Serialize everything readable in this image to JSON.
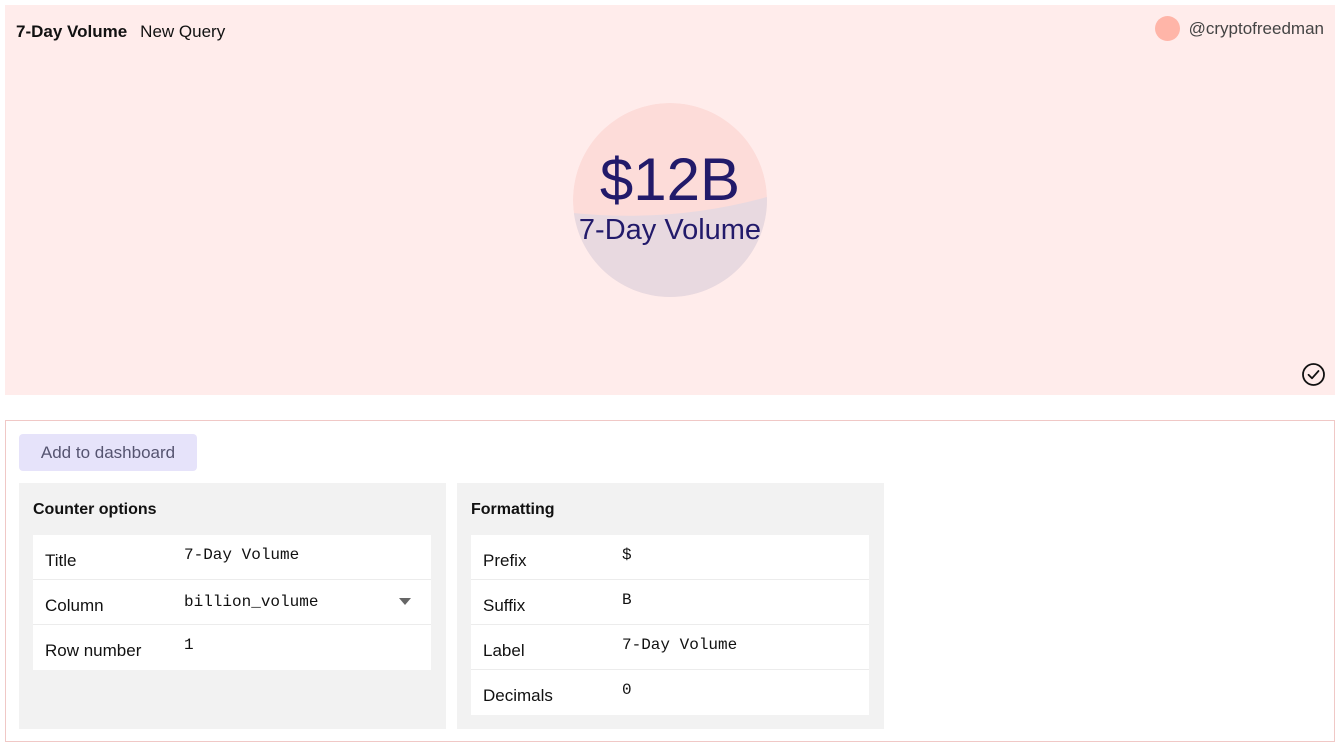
{
  "header": {
    "query_title": "7-Day Volume",
    "query_name": "New Query",
    "author": "@cryptofreedman"
  },
  "counter": {
    "value": "$12B",
    "label": "7-Day Volume"
  },
  "actions": {
    "add_to_dashboard": "Add to dashboard"
  },
  "counter_options": {
    "title": "Counter options",
    "rows": [
      {
        "label": "Title",
        "value": "7-Day Volume"
      },
      {
        "label": "Column",
        "value": "billion_volume"
      },
      {
        "label": "Row number",
        "value": "1"
      }
    ]
  },
  "formatting": {
    "title": "Formatting",
    "rows": [
      {
        "label": "Prefix",
        "value": "$"
      },
      {
        "label": "Suffix",
        "value": "B"
      },
      {
        "label": "Label",
        "value": "7-Day Volume"
      },
      {
        "label": "Decimals",
        "value": "0"
      }
    ]
  },
  "colors": {
    "preview_bg": "#ffeceb",
    "counter_text": "#221a6a",
    "avatar": "#ffb5a8",
    "button_bg": "#e6e3fa"
  },
  "icons": {
    "status": "check-circle-icon",
    "select": "chevron-down-icon"
  }
}
